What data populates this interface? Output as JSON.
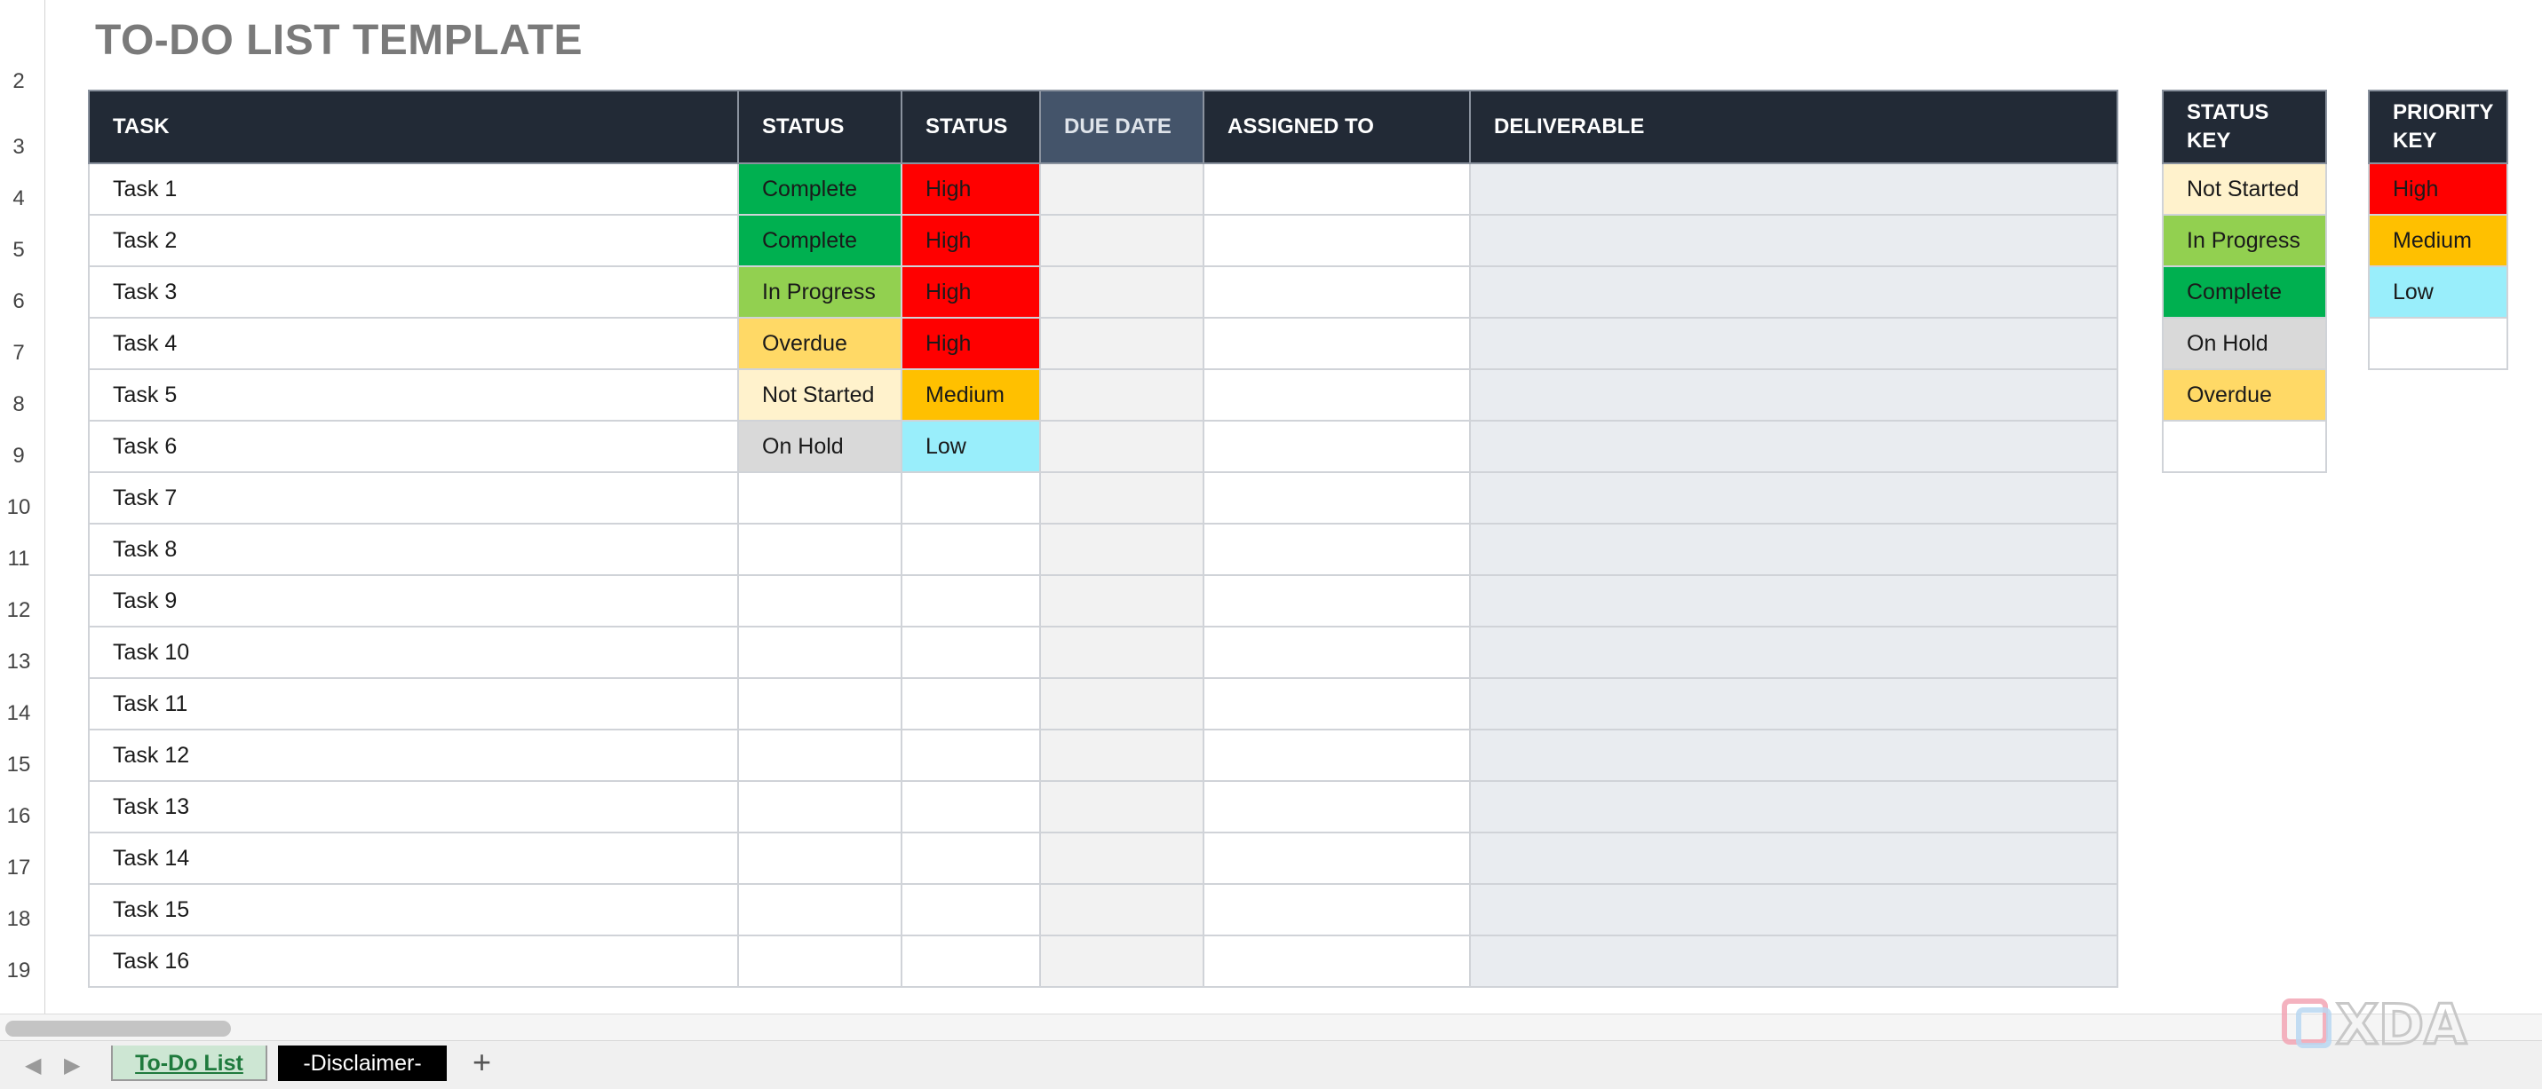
{
  "title": "TO-DO LIST TEMPLATE",
  "row_numbers": [
    "2",
    "3",
    "4",
    "5",
    "6",
    "7",
    "8",
    "9",
    "10",
    "11",
    "12",
    "13",
    "14",
    "15",
    "16",
    "17",
    "18",
    "19"
  ],
  "table": {
    "headers": [
      "TASK",
      "STATUS",
      "STATUS",
      "DUE DATE",
      "ASSIGNED TO",
      "DELIVERABLE"
    ],
    "rows": [
      {
        "task": "Task 1",
        "status": "Complete",
        "priority": "High"
      },
      {
        "task": "Task 2",
        "status": "Complete",
        "priority": "High"
      },
      {
        "task": "Task 3",
        "status": "In Progress",
        "priority": "High"
      },
      {
        "task": "Task 4",
        "status": "Overdue",
        "priority": "High"
      },
      {
        "task": "Task 5",
        "status": "Not Started",
        "priority": "Medium"
      },
      {
        "task": "Task 6",
        "status": "On Hold",
        "priority": "Low"
      },
      {
        "task": "Task 7",
        "status": "",
        "priority": ""
      },
      {
        "task": "Task 8",
        "status": "",
        "priority": ""
      },
      {
        "task": "Task 9",
        "status": "",
        "priority": ""
      },
      {
        "task": "Task 10",
        "status": "",
        "priority": ""
      },
      {
        "task": "Task 11",
        "status": "",
        "priority": ""
      },
      {
        "task": "Task 12",
        "status": "",
        "priority": ""
      },
      {
        "task": "Task 13",
        "status": "",
        "priority": ""
      },
      {
        "task": "Task 14",
        "status": "",
        "priority": ""
      },
      {
        "task": "Task 15",
        "status": "",
        "priority": ""
      },
      {
        "task": "Task 16",
        "status": "",
        "priority": ""
      }
    ]
  },
  "status_key": {
    "header_line1": "STATUS",
    "header_line2": "KEY",
    "items": [
      "Not Started",
      "In Progress",
      "Complete",
      "On Hold",
      "Overdue",
      ""
    ]
  },
  "priority_key": {
    "header_line1": "PRIORITY",
    "header_line2": "KEY",
    "items": [
      "High",
      "Medium",
      "Low",
      ""
    ]
  },
  "colors": {
    "Complete": "#00b050",
    "In Progress": "#92d050",
    "Overdue": "#ffd966",
    "Not Started": "#fff2cc",
    "On Hold": "#d9d9d9",
    "High": "#ff0000",
    "Medium": "#ffc000",
    "Low": "#99eefb"
  },
  "sheet_tabs": [
    "To-Do List",
    "-Disclaimer-"
  ],
  "add_sheet": "+",
  "watermark": "XDA"
}
